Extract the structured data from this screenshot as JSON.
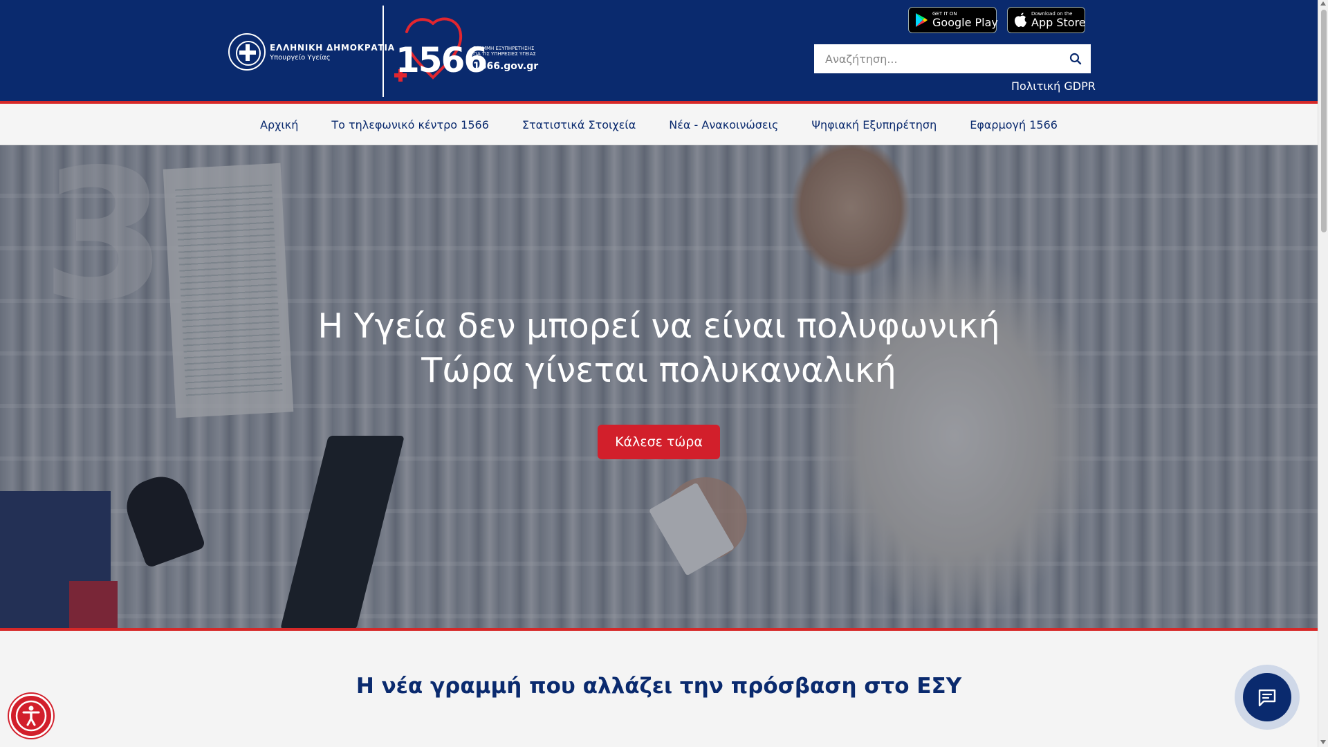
{
  "header": {
    "gov_logo": {
      "line1": "ΕΛΛΗΝΙΚΗ ΔΗΜΟΚΡΑΤΙΑ",
      "line2": "Υπουργείο Υγείας"
    },
    "brand_logo": {
      "number": "1566",
      "tagline1": "ΓΡΑΜΜΗ ΕΞΥΠΗΡΕΤΗΣΗΣ",
      "tagline2": "ΓΙΑ ΤΙΣ ΥΠΗΡΕΣΙΕΣ ΥΓΕΙΑΣ",
      "domain": "1566.gov.gr"
    },
    "stores": {
      "google_small": "GET IT ON",
      "google_big": "Google Play",
      "apple_small": "Download on the",
      "apple_big": "App Store"
    },
    "search": {
      "placeholder": "Αναζήτηση...",
      "value": ""
    },
    "gdpr_label": "Πολιτική GDPR",
    "colors": {
      "primary": "#0a2a6e",
      "accent_red": "#d62828"
    }
  },
  "nav": {
    "items": [
      {
        "label": "Αρχική"
      },
      {
        "label": "Το τηλεφωνικό κέντρο 1566"
      },
      {
        "label": "Στατιστικά Στοιχεία"
      },
      {
        "label": "Νέα - Ανακοινώσεις"
      },
      {
        "label": "Ψηφιακή Εξυπηρέτηση"
      },
      {
        "label": "Εφαρμογή 1566"
      }
    ]
  },
  "hero": {
    "line1": "Η Υγεία δεν μπορεί να είναι πολυφωνική",
    "line2": "Τώρα γίνεται πολυκαναλική",
    "cta_label": "Κάλεσε τώρα"
  },
  "section": {
    "title": "Η νέα γραμμή που αλλάζει την πρόσβαση στο ΕΣΥ"
  },
  "icons": {
    "search": "search-icon",
    "accessibility": "accessibility-icon",
    "chat": "chat-icon",
    "google_play": "google-play-icon",
    "apple": "apple-icon"
  }
}
